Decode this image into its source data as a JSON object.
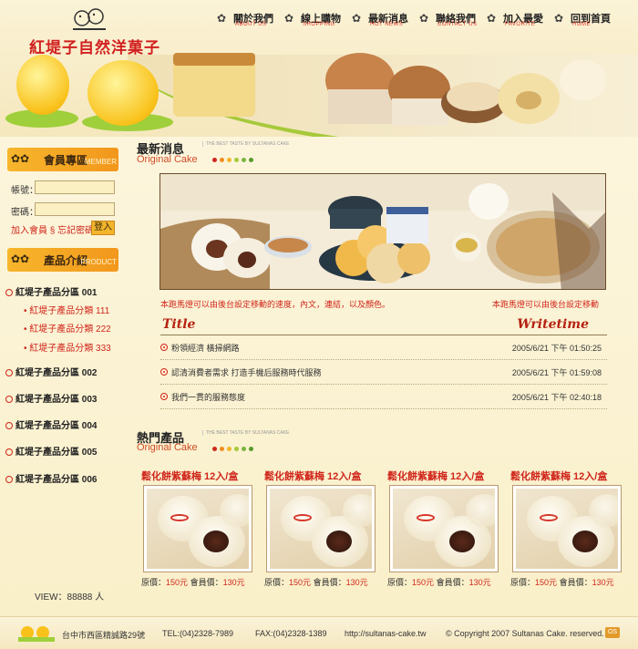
{
  "brand": {
    "logo_text": "紅堤子自然洋菓子"
  },
  "topnav": [
    {
      "zh": "關於我們",
      "en": "ABOUT US"
    },
    {
      "zh": "線上購物",
      "en": "SHOPPING"
    },
    {
      "zh": "最新消息",
      "en": "HOT NEWS"
    },
    {
      "zh": "聯絡我們",
      "en": "CONTACT US"
    },
    {
      "zh": "加入最愛",
      "en": "FAVORITE"
    },
    {
      "zh": "回到首頁",
      "en": "HOME"
    }
  ],
  "member": {
    "title_zh": "會員專區",
    "title_en": "MEMBER",
    "account_label": "帳號：",
    "password_label": "密碼：",
    "join_link": "加入會員 § 忘記密碼",
    "login_button": "登入"
  },
  "products_menu": {
    "title_zh": "產品介紹",
    "title_en": "PRODUCT",
    "categories": [
      {
        "label": "紅堤子產品分區 001"
      },
      {
        "label": "紅堤子產品分區 002"
      },
      {
        "label": "紅堤子產品分區 003"
      },
      {
        "label": "紅堤子產品分區 004"
      },
      {
        "label": "紅堤子產品分區 005"
      },
      {
        "label": "紅堤子產品分區 006"
      }
    ],
    "subcategories": [
      "紅堤子產品分類 111",
      "紅堤子產品分類 222",
      "紅堤子產品分類 333"
    ]
  },
  "view_count": "VIEW：88888 人",
  "news": {
    "title": "最新消息",
    "subtitle": "Original Cake",
    "tag": "THE BEST TASTE BY SULTANAS CAKE",
    "marquee_left": "本跑馬燈可以由後台設定移動的速度，內文，連結，以及顏色。",
    "marquee_right": "本跑馬燈可以由後台設定移動",
    "col_title": "Title",
    "col_time": "Writetime",
    "items": [
      {
        "title": "粉領經濟 橫掃網路",
        "time": "2005/6/21 下午 01:50:25"
      },
      {
        "title": "認清消費者需求 打造手機后服務時代服務",
        "time": "2005/6/21 下午 01:59:08"
      },
      {
        "title": "我們一貫的服務態度",
        "time": "2005/6/21 下午 02:40:18"
      }
    ]
  },
  "hot": {
    "title": "熱門產品",
    "subtitle": "Original Cake",
    "tag": "THE BEST TASTE BY SULTANAS CAKE",
    "items": [
      {
        "name": "鬆化餅紫蘇梅  12入/盒",
        "orig_label": "原價：",
        "orig": "150元",
        "member_label": "會員價：",
        "member": "130元"
      },
      {
        "name": "鬆化餅紫蘇梅  12入/盒",
        "orig_label": "原價：",
        "orig": "150元",
        "member_label": "會員價：",
        "member": "130元"
      },
      {
        "name": "鬆化餅紫蘇梅  12入/盒",
        "orig_label": "原價：",
        "orig": "150元",
        "member_label": "會員價：",
        "member": "130元"
      },
      {
        "name": "鬆化餅紫蘇梅  12入/盒",
        "orig_label": "原價：",
        "orig": "150元",
        "member_label": "會員價：",
        "member": "130元"
      }
    ]
  },
  "footer": {
    "address": "台中市西區精誠路29號",
    "tel": "TEL:(04)2328-7989",
    "fax": "FAX:(04)2328-1389",
    "url": "http://sultanas-cake.tw",
    "copyright": "© Copyright 2007 Sultanas Cake. reserved.",
    "top_button": "OS"
  },
  "colors": {
    "accent": "#d0261b",
    "orange": "#f3b52b",
    "green": "#a6c93a"
  }
}
